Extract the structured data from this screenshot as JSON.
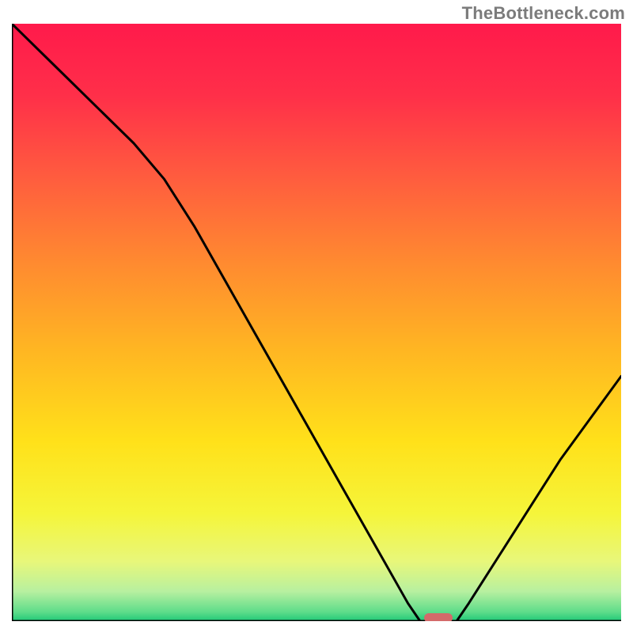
{
  "watermark": "TheBottleneck.com",
  "chart_data": {
    "type": "line",
    "title": "",
    "xlabel": "",
    "ylabel": "",
    "x_range": [
      0,
      100
    ],
    "y_range": [
      0,
      100
    ],
    "series": [
      {
        "name": "bottleneck-curve",
        "x": [
          0,
          5,
          10,
          15,
          20,
          25,
          30,
          35,
          40,
          45,
          50,
          55,
          60,
          65,
          67,
          70,
          73,
          75,
          80,
          85,
          90,
          95,
          100
        ],
        "y": [
          100,
          95,
          90,
          85,
          80,
          74,
          66,
          57,
          48,
          39,
          30,
          21,
          12,
          3,
          0,
          0,
          0,
          3,
          11,
          19,
          27,
          34,
          41
        ],
        "color": "#000000"
      }
    ],
    "marker": {
      "name": "optimal-point",
      "x": 70,
      "y": 0,
      "color": "#d46a6a",
      "shape": "capsule"
    },
    "background": {
      "type": "vertical-gradient",
      "stops": [
        {
          "pos": 0.0,
          "color": "#ff1a4b"
        },
        {
          "pos": 0.12,
          "color": "#ff2f49"
        },
        {
          "pos": 0.25,
          "color": "#ff5a3f"
        },
        {
          "pos": 0.4,
          "color": "#ff8a30"
        },
        {
          "pos": 0.55,
          "color": "#ffb722"
        },
        {
          "pos": 0.7,
          "color": "#ffe11a"
        },
        {
          "pos": 0.82,
          "color": "#f5f53a"
        },
        {
          "pos": 0.9,
          "color": "#e8f77a"
        },
        {
          "pos": 0.95,
          "color": "#b8f0a0"
        },
        {
          "pos": 0.985,
          "color": "#5ddc8a"
        },
        {
          "pos": 1.0,
          "color": "#1fc877"
        }
      ]
    },
    "axes": {
      "show_ticks": false,
      "show_grid": false,
      "border_color": "#000000",
      "border_sides": [
        "left",
        "bottom"
      ]
    }
  }
}
